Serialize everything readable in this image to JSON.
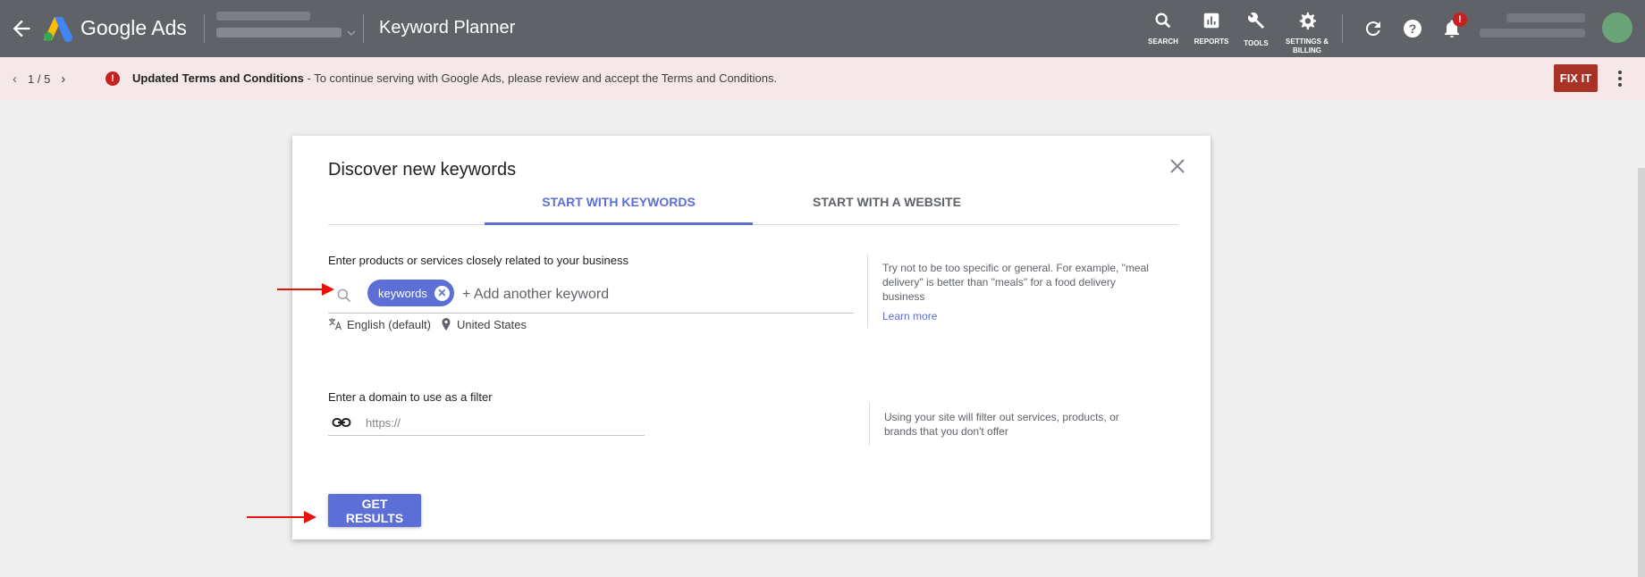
{
  "header": {
    "brand": "Google Ads",
    "page_title": "Keyword Planner",
    "tools": [
      {
        "label": "SEARCH",
        "icon": "search-icon"
      },
      {
        "label": "REPORTS",
        "icon": "reports-icon"
      },
      {
        "label": "TOOLS",
        "icon": "wrench-icon"
      },
      {
        "label": "SETTINGS & BILLING",
        "icon": "gear-icon"
      }
    ],
    "notification_badge": "!"
  },
  "notice": {
    "pager": "1 / 5",
    "alert_icon": "!",
    "title": "Updated Terms and Conditions",
    "message": " - To continue serving with Google Ads, please review and accept the Terms and Conditions.",
    "action": "FIX IT"
  },
  "dialog": {
    "title": "Discover new keywords",
    "tabs": [
      {
        "label": "START WITH KEYWORDS",
        "active": true
      },
      {
        "label": "START WITH A WEBSITE",
        "active": false
      }
    ],
    "keywords": {
      "label": "Enter products or services closely related to your business",
      "chips": [
        "keywords"
      ],
      "placeholder": "+ Add another keyword",
      "language": "English (default)",
      "location": "United States",
      "tip": "Try not to be too specific or general. For example, \"meal delivery\" is better than \"meals\" for a food delivery business",
      "learn_more": "Learn more"
    },
    "domain": {
      "label": "Enter a domain to use as a filter",
      "placeholder": "https://",
      "tip": "Using your site will filter out services, products, or brands that you don't offer"
    },
    "submit": "GET RESULTS"
  },
  "colors": {
    "accent": "#5b6fd6",
    "topbar": "#5f6368",
    "notice_bg": "#f6e8e8",
    "fixit": "#a93226",
    "arrow": "#e8120c"
  }
}
